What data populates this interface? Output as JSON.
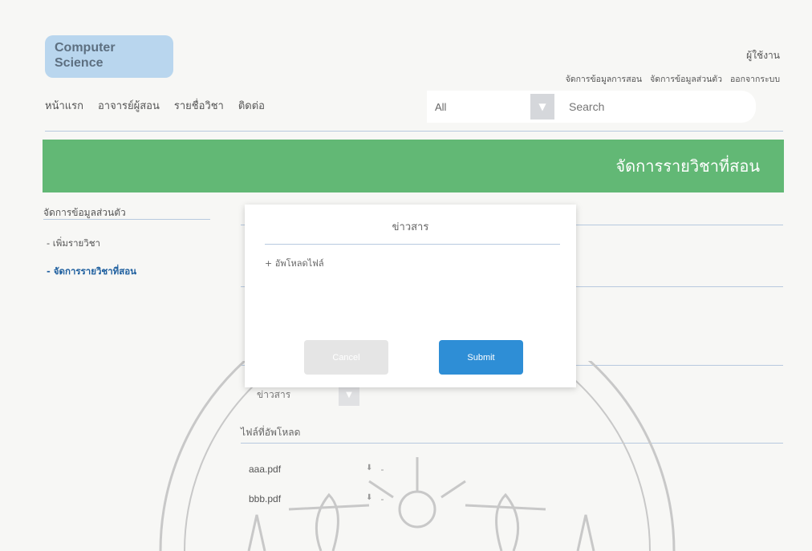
{
  "brand": {
    "line1": "Computer",
    "line2": "Science"
  },
  "header": {
    "user_label": "ผู้ใช้งาน",
    "links": [
      "จัดการข้อมูลการสอน",
      "จัดการข้อมูลส่วนตัว",
      "ออกจากระบบ"
    ]
  },
  "nav": {
    "items": [
      "หน้าแรก",
      "อาจารย์ผู้สอน",
      "รายชื่อวิชา",
      "ติดต่อ"
    ]
  },
  "search": {
    "filter_value": "All",
    "placeholder": "Search"
  },
  "banner": {
    "title": "จัดการรายวิชาที่สอน"
  },
  "sidebar": {
    "title": "จัดการข้อมูลส่วนตัว",
    "items": [
      {
        "label": "- เพิ่มรายวิชา",
        "active": false
      },
      {
        "label": "- จัดการรายวิชาที่สอน",
        "active": true
      }
    ]
  },
  "content": {
    "category_select": "ข่าวสาร",
    "files_title": "ไฟล์ที่อัพโหลด",
    "files": [
      {
        "name": "aaa.pdf",
        "dash": "-"
      },
      {
        "name": "bbb.pdf",
        "dash": "-"
      }
    ]
  },
  "modal": {
    "title": "ข่าวสาร",
    "upload_link": "+ อัพโหลดไฟล์",
    "cancel_label": "Cancel",
    "submit_label": "Submit"
  },
  "colors": {
    "banner": "#62b875",
    "logo": "#b9d6ee",
    "active_link": "#1d5e9e",
    "submit": "#2e8ed6",
    "cancel": "#e5e5e5"
  }
}
